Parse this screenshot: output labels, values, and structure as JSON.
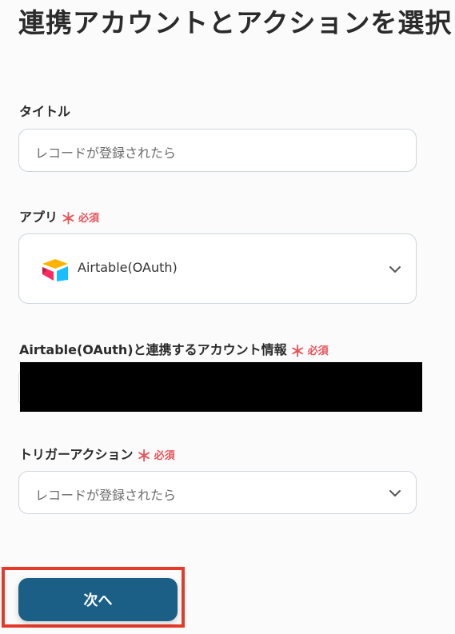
{
  "page": {
    "title": "連携アカウントとアクションを選択"
  },
  "fields": {
    "title": {
      "label": "タイトル",
      "value": "レコードが登録されたら"
    },
    "app": {
      "label": "アプリ",
      "required_mark": "＊",
      "required_text": "必須",
      "value": "Airtable(OAuth)",
      "icon": "airtable-logo"
    },
    "account": {
      "label": "Airtable(OAuth)と連携するアカウント情報",
      "required_mark": "＊",
      "required_text": "必須"
    },
    "trigger": {
      "label": "トリガーアクション",
      "required_mark": "＊",
      "required_text": "必須",
      "value": "レコードが登録されたら"
    }
  },
  "actions": {
    "next_label": "次へ"
  },
  "colors": {
    "primary": "#1b5f86",
    "required": "#e8545a",
    "highlight": "#e53a2a"
  }
}
